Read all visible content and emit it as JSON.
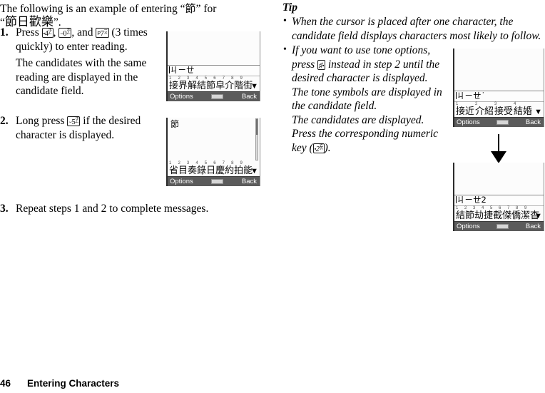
{
  "document": {
    "footer_page_number": "46",
    "footer_chapter": "Entering Characters"
  },
  "left_column": {
    "intro": {
      "line1_prefix": "The following is an example of entering “",
      "line1_char": "節",
      "line1_suffix": "” for",
      "line2_prefix": "“",
      "line2_chars": "節日歡樂",
      "line2_suffix": "”."
    },
    "steps": [
      {
        "number": "1.",
        "segments": {
          "lead": "Press ",
          "key1": {
            "left": "▪",
            "digit": "4",
            "right_top": "ホ",
            "right_bottom": "ㄥ"
          },
          "mid1": ", ",
          "key2": {
            "left": "⌣",
            "digit": "0",
            "right_top": "ホ",
            "right_bottom": "ㄥ"
          },
          "mid2": ", and ",
          "key3": {
            "left": "P",
            "digit": "7",
            "right_top": "ㄧ",
            "right_bottom": "ㄨ"
          },
          "tail": " (3 times quickly) to enter reading."
        },
        "note": "The candidates with the same reading are displayed in the candidate field."
      },
      {
        "number": "2.",
        "segments": {
          "lead": "Long press ",
          "key1": {
            "left": "⌣",
            "digit": "5",
            "right_top": "ホ",
            "right_bottom": "ㄥ"
          },
          "tail": " if the desired character is displayed."
        },
        "note": ""
      },
      {
        "number": "3.",
        "segments": {
          "lead": "Repeat steps 1 and 2 to complete messages.",
          "tail": ""
        },
        "note": ""
      }
    ]
  },
  "right_column": {
    "tip_heading": "Tip",
    "tips": [
      {
        "text": "When the cursor is placed after one character, the candidate field displays characters most likely to follow.",
        "narrow": false
      },
      {
        "text_part1": "If you want to use tone options, press ",
        "key": {
          "left": "♯",
          "digit": "",
          "right_top": "▪",
          "right_bottom": ""
        },
        "text_part2": " instead in step 2 until the desired character is displayed. The tone symbols are displayed in the candidate field.",
        "text_part3": "The candidates are displayed. Press the corresponding numeric key (",
        "key2": {
          "left": "▪",
          "digit": "2",
          "right_top": "ㄊ",
          "right_bottom": "ㄞ"
        },
        "text_part4": ").",
        "narrow": true
      }
    ]
  },
  "screens": [
    {
      "id": "screen-step1",
      "text_area": "",
      "reading": "ㄐㄧㄝ",
      "reading_has_caret": true,
      "candidate_numbers": [
        "1",
        "2",
        "3",
        "4",
        "5",
        "6",
        "7",
        "8",
        "9"
      ],
      "candidates": [
        "接",
        "界",
        "解",
        "結",
        "節",
        "皁",
        "介",
        "階",
        "街"
      ],
      "more_indicator": "▼",
      "softkey_left": "Options",
      "softkey_right": "Back"
    },
    {
      "id": "screen-step2",
      "text_area": "節",
      "reading": "",
      "reading_has_caret": false,
      "candidate_numbers": [
        "1",
        "2",
        "3",
        "4",
        "5",
        "6",
        "7",
        "8",
        "9"
      ],
      "candidates": [
        "省",
        "目",
        "奏",
        "錄",
        "日",
        "慶",
        "約",
        "拍",
        "能"
      ],
      "more_indicator": "▼",
      "softkey_left": "Options",
      "softkey_right": "Back"
    },
    {
      "id": "screen-tip-tone",
      "text_area": "",
      "reading": "ㄐㄧㄝ˙",
      "reading_has_caret": true,
      "candidate_numbers": [
        "1",
        "2",
        "3",
        "4"
      ],
      "candidates": [
        "接近",
        "介紹",
        "接受",
        "結婚"
      ],
      "more_indicator": "▼",
      "softkey_left": "Options",
      "softkey_right": "Back"
    },
    {
      "id": "screen-tip-result",
      "text_area": "",
      "reading": "ㄐㄧㄝ2",
      "reading_has_caret": true,
      "candidate_numbers": [
        "1",
        "2",
        "3",
        "4",
        "5",
        "6",
        "7",
        "8",
        "9"
      ],
      "candidates": [
        "結",
        "節",
        "劫",
        "捷",
        "截",
        "傑",
        "僑",
        "潔",
        "杳"
      ],
      "more_indicator": "▼",
      "softkey_left": "Options",
      "softkey_right": "Back"
    }
  ]
}
